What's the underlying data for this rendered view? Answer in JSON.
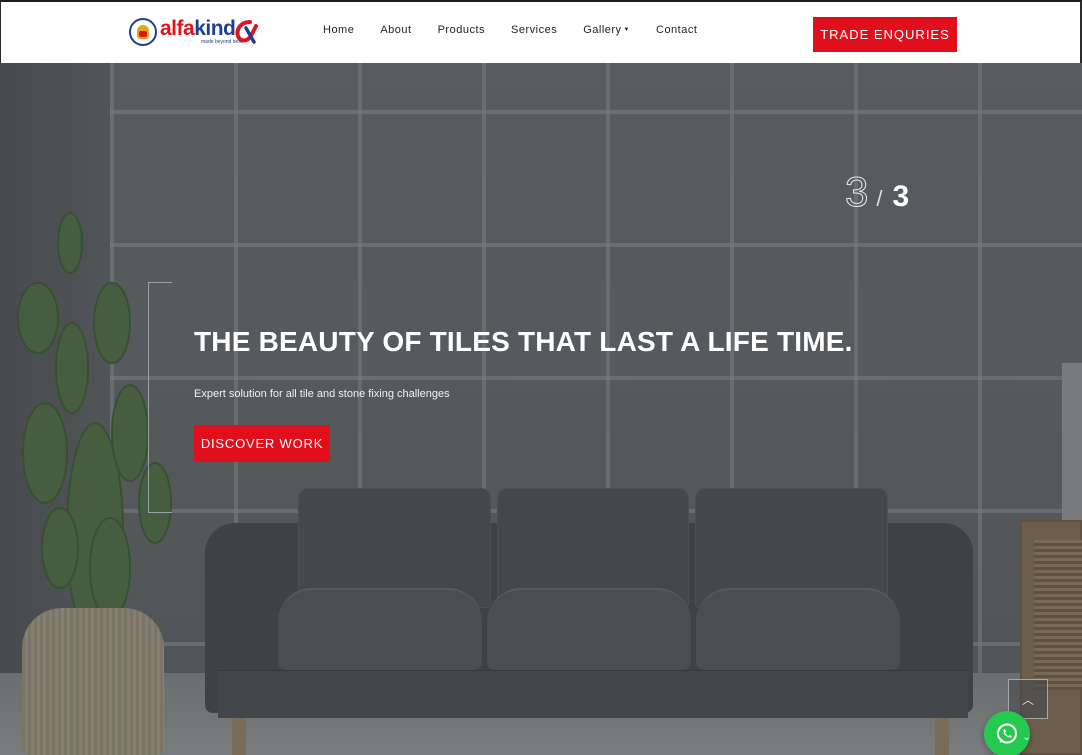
{
  "header": {
    "logo": {
      "brand_part1": "alfa",
      "brand_part2": "kind",
      "tagline": "made beyond best"
    },
    "nav": [
      {
        "label": "Home"
      },
      {
        "label": "About"
      },
      {
        "label": "Products"
      },
      {
        "label": "Services"
      },
      {
        "label": "Gallery",
        "has_dropdown": true
      },
      {
        "label": "Contact"
      }
    ],
    "cta_label": "TRADE ENQURIES"
  },
  "hero": {
    "slide_current": "3",
    "slide_separator": "/",
    "slide_total": "3",
    "title": "THE BEAUTY OF TILES THAT LAST A LIFE TIME.",
    "subtitle": "Expert solution for all tile and stone fixing challenges",
    "button_label": "DISCOVER WORK"
  },
  "floating": {
    "scroll_top_icon": "chevron-up-icon",
    "whatsapp_icon": "whatsapp-icon"
  },
  "colors": {
    "accent": "#e10f1b",
    "brand_blue": "#1f3f8f",
    "whatsapp": "#25c94f"
  }
}
